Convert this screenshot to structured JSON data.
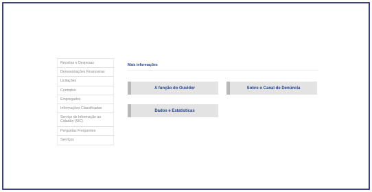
{
  "sidebar": {
    "items": [
      {
        "label": "Receitas e Despesas"
      },
      {
        "label": "Demonstrações Financeiras"
      },
      {
        "label": "Licitações"
      },
      {
        "label": "Contratos"
      },
      {
        "label": "Empregados"
      },
      {
        "label": "Informações Classificadas"
      },
      {
        "label": "Serviço de Informação ao Cidadão (SIC)"
      },
      {
        "label": "Perguntas Frequentes"
      },
      {
        "label": "Serviços"
      }
    ]
  },
  "more_info": {
    "title": "Mais informações",
    "links": [
      {
        "label": "A função do Ouvidor"
      },
      {
        "label": "Sobre o Canal de Denúncia"
      },
      {
        "label": "Dados e Estatísticas"
      }
    ]
  },
  "colors": {
    "frame_border": "#3a3f86",
    "link_text": "#1f3f8f",
    "box_bg": "#e3e3e3",
    "box_accent": "#b8b8b8"
  }
}
